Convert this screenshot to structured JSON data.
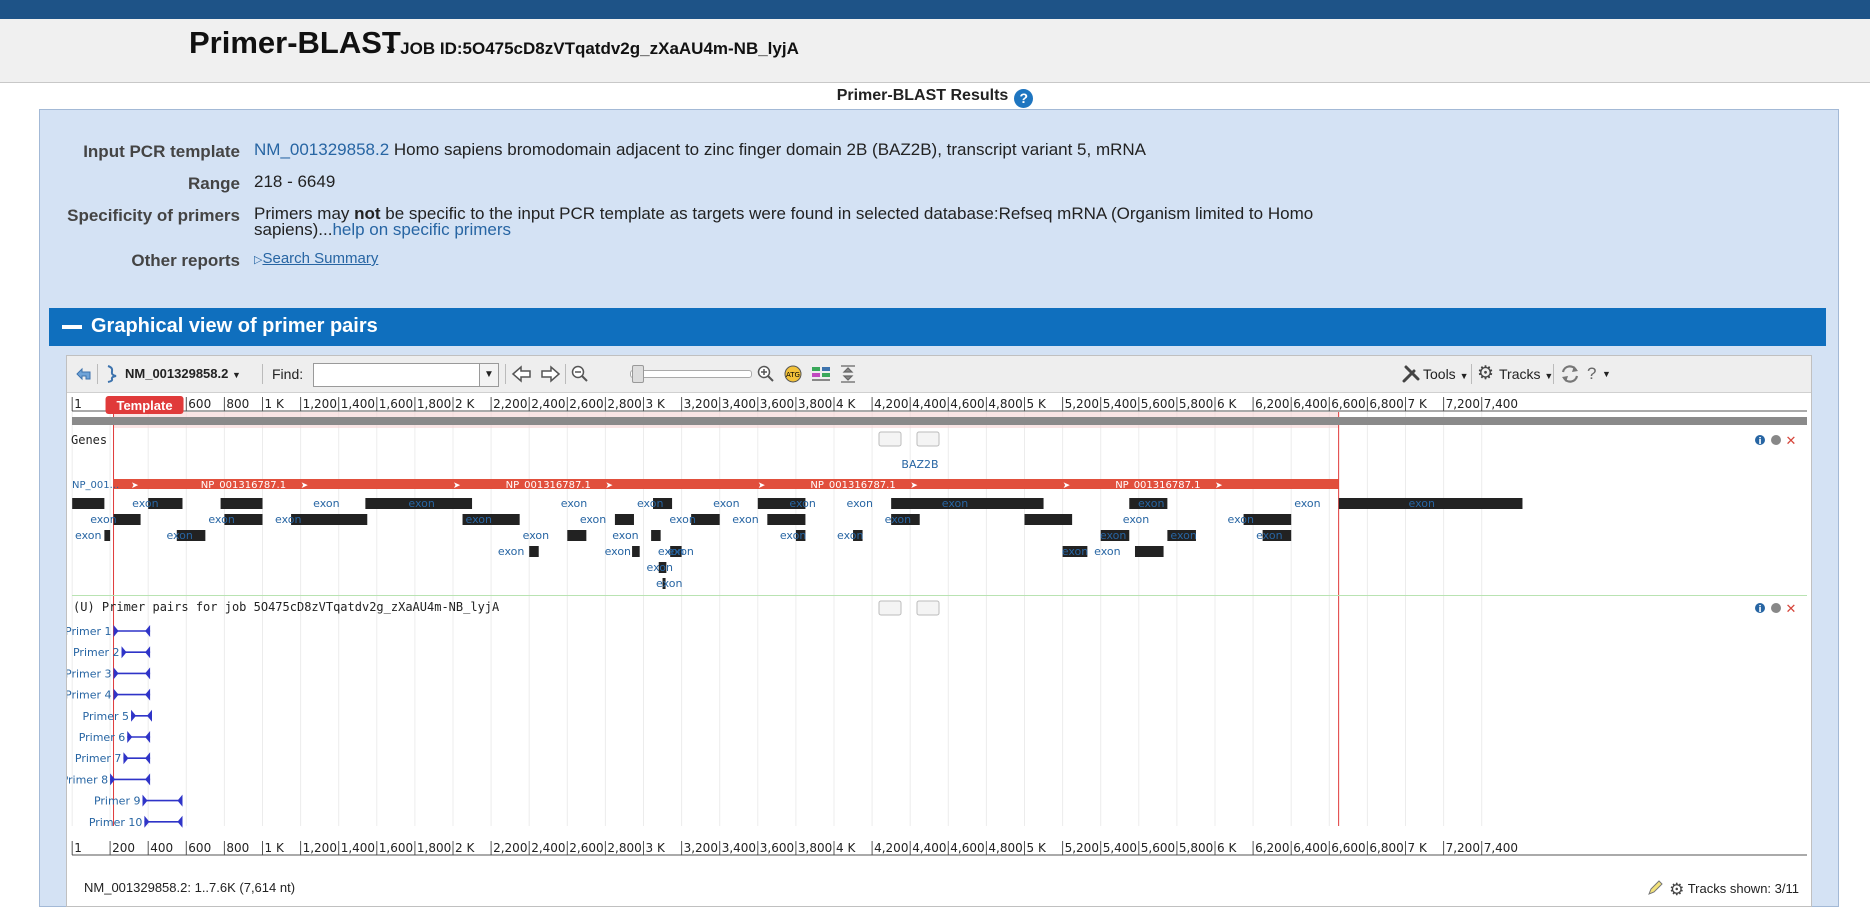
{
  "header": {
    "title": "Primer-BLAST",
    "job_label": "» JOB ID:5O475cD8zVTqatdv2g_zXaAU4m-NB_lyjA"
  },
  "results": {
    "title": "Primer-BLAST Results",
    "help_glyph": "?"
  },
  "info": {
    "template_label": "Input PCR template",
    "template_accession": "NM_001329858.2",
    "template_description": " Homo sapiens bromodomain adjacent to zinc finger domain 2B (BAZ2B), transcript variant 5, mRNA",
    "range_label": "Range",
    "range_value": "218 - 6649",
    "specificity_label": "Specificity of primers",
    "specificity_pre": "Primers may ",
    "specificity_bold": "not",
    "specificity_post": " be specific to the input PCR template as targets were found in selected database:Refseq mRNA (Organism limited to Homo sapiens)...",
    "specificity_link": "help on specific primers",
    "other_label": "Other reports",
    "other_arrow": "▷",
    "other_link": "Search Summary"
  },
  "section": {
    "title": "Graphical view of primer pairs"
  },
  "viewer": {
    "sequence_button": "NM_001329858.2",
    "find_label": "Find:",
    "find_value": "",
    "tools_label": "Tools",
    "tracks_label": "Tracks",
    "ruler_ticks": [
      "1",
      "200",
      "400",
      "600",
      "800",
      "1 K",
      "1,200",
      "1,400",
      "1,600",
      "1,800",
      "2 K",
      "2,200",
      "2,400",
      "2,600",
      "2,800",
      "3 K",
      "3,200",
      "3,400",
      "3,600",
      "3,800",
      "4 K",
      "4,200",
      "4,400",
      "4,600",
      "4,800",
      "5 K",
      "5,200",
      "5,400",
      "5,600",
      "5,800",
      "6 K",
      "6,200",
      "6,400",
      "6,600",
      "6,800",
      "7 K",
      "7,200",
      "7,400"
    ],
    "template_marker": "Template",
    "genes_track": {
      "label": "Genes",
      "gene_name": "BAZ2B",
      "np_short": "NP_001...",
      "np_label": "NP_001316787.1",
      "exon_label": "exon"
    },
    "primer_track": {
      "label": "(U) Primer pairs for job 5O475cD8zVTqatdv2g_zXaAU4m-NB_lyjA",
      "primers": [
        {
          "name": "Primer 1",
          "start": 218,
          "end": 410
        },
        {
          "name": "Primer 2",
          "start": 260,
          "end": 410
        },
        {
          "name": "Primer 3",
          "start": 218,
          "end": 410
        },
        {
          "name": "Primer 4",
          "start": 218,
          "end": 410
        },
        {
          "name": "Primer 5",
          "start": 310,
          "end": 420
        },
        {
          "name": "Primer 6",
          "start": 290,
          "end": 410
        },
        {
          "name": "Primer 7",
          "start": 270,
          "end": 410
        },
        {
          "name": "Primer 8",
          "start": 200,
          "end": 410
        },
        {
          "name": "Primer 9",
          "start": 370,
          "end": 580
        },
        {
          "name": "Primer 10",
          "start": 380,
          "end": 580
        }
      ]
    },
    "status_left": "NM_001329858.2: 1..7.6K (7,614 nt)",
    "status_right": "Tracks shown: 3/11"
  }
}
